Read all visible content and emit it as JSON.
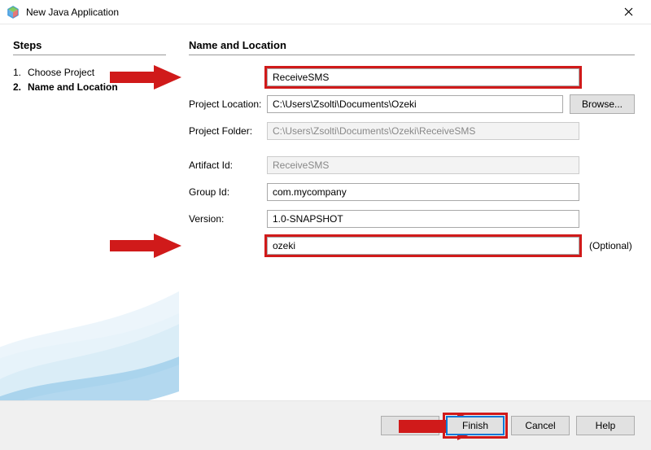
{
  "window": {
    "title": "New Java Application"
  },
  "steps": {
    "heading": "Steps",
    "items": [
      {
        "num": "1.",
        "label": "Choose Project",
        "current": false
      },
      {
        "num": "2.",
        "label": "Name and Location",
        "current": true
      }
    ]
  },
  "content": {
    "heading": "Name and Location",
    "projectName": {
      "label": "",
      "value": "ReceiveSMS"
    },
    "projectLocation": {
      "label": "Project Location:",
      "value": "C:\\Users\\Zsolti\\Documents\\Ozeki",
      "browse": "Browse..."
    },
    "projectFolder": {
      "label": "Project Folder:",
      "value": "C:\\Users\\Zsolti\\Documents\\Ozeki\\ReceiveSMS"
    },
    "artifactId": {
      "label": "Artifact Id:",
      "value": "ReceiveSMS"
    },
    "groupId": {
      "label": "Group Id:",
      "value": "com.mycompany"
    },
    "version": {
      "label": "Version:",
      "value": "1.0-SNAPSHOT"
    },
    "pkg": {
      "label": "",
      "value": "ozeki",
      "note": "(Optional)"
    }
  },
  "footer": {
    "back": "< Ba",
    "next": "",
    "finish": "Finish",
    "cancel": "Cancel",
    "help": "Help"
  }
}
